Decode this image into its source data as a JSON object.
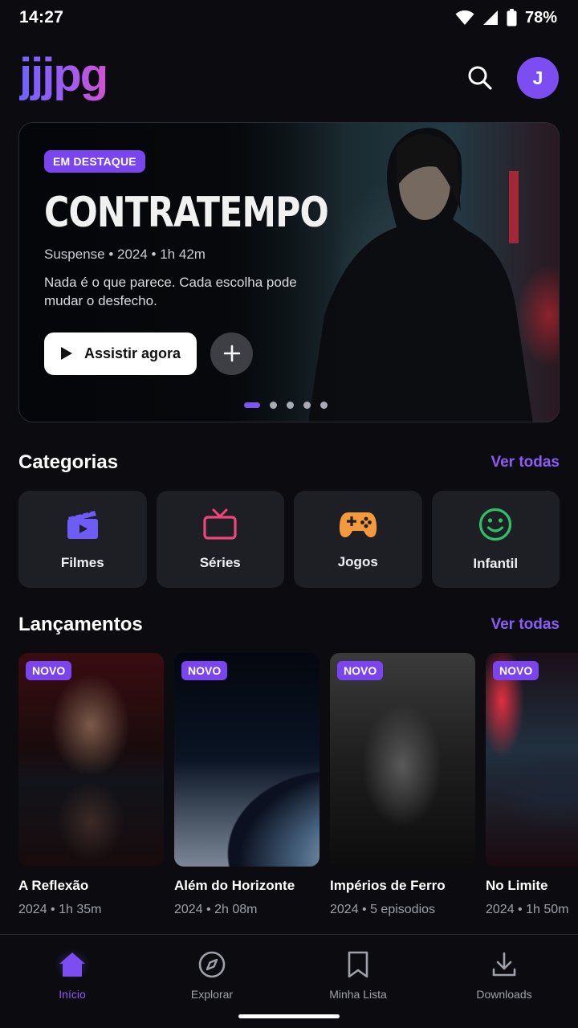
{
  "status_bar": {
    "time": "14:27",
    "battery": "78%"
  },
  "header": {
    "logo": "jjjpg",
    "avatar_initial": "J"
  },
  "hero": {
    "badge": "EM DESTAQUE",
    "title": "CONTRATEMPO",
    "meta": "Suspense • 2024 • 1h 42m",
    "description": "Nada é o que parece. Cada escolha pode mudar o desfecho.",
    "play_label": "Assistir agora",
    "carousel_active_index": 0,
    "carousel_count": 5
  },
  "categories": {
    "title": "Categorias",
    "link": "Ver todas",
    "items": [
      {
        "label": "Filmes",
        "icon": "clapperboard-icon",
        "color": "#6d5cf5"
      },
      {
        "label": "Séries",
        "icon": "tv-icon",
        "color": "#f0457a"
      },
      {
        "label": "Jogos",
        "icon": "gamepad-icon",
        "color": "#f59a3c"
      },
      {
        "label": "Infantil",
        "icon": "smiley-icon",
        "color": "#2fc06a"
      }
    ]
  },
  "releases": {
    "title": "Lançamentos",
    "link": "Ver todas",
    "items": [
      {
        "badge": "NOVO",
        "title": "A Reflexão",
        "meta": "2024 • 1h 35m"
      },
      {
        "badge": "NOVO",
        "title": "Além do Horizonte",
        "meta": "2024 • 2h 08m"
      },
      {
        "badge": "NOVO",
        "title": "Impérios de Ferro",
        "meta": "2024 • 5 episodios"
      },
      {
        "badge": "NOVO",
        "title": "No Limite",
        "meta": "2024 • 1h 50m"
      }
    ]
  },
  "bottom_nav": {
    "items": [
      {
        "label": "Início",
        "icon": "home-icon",
        "active": true
      },
      {
        "label": "Explorar",
        "icon": "compass-icon",
        "active": false
      },
      {
        "label": "Minha Lista",
        "icon": "bookmark-icon",
        "active": false
      },
      {
        "label": "Downloads",
        "icon": "download-icon",
        "active": false
      }
    ]
  },
  "colors": {
    "accent": "#7c4df1",
    "link": "#8b5cf6",
    "background": "#0c0c10",
    "card": "#1d1f25"
  }
}
